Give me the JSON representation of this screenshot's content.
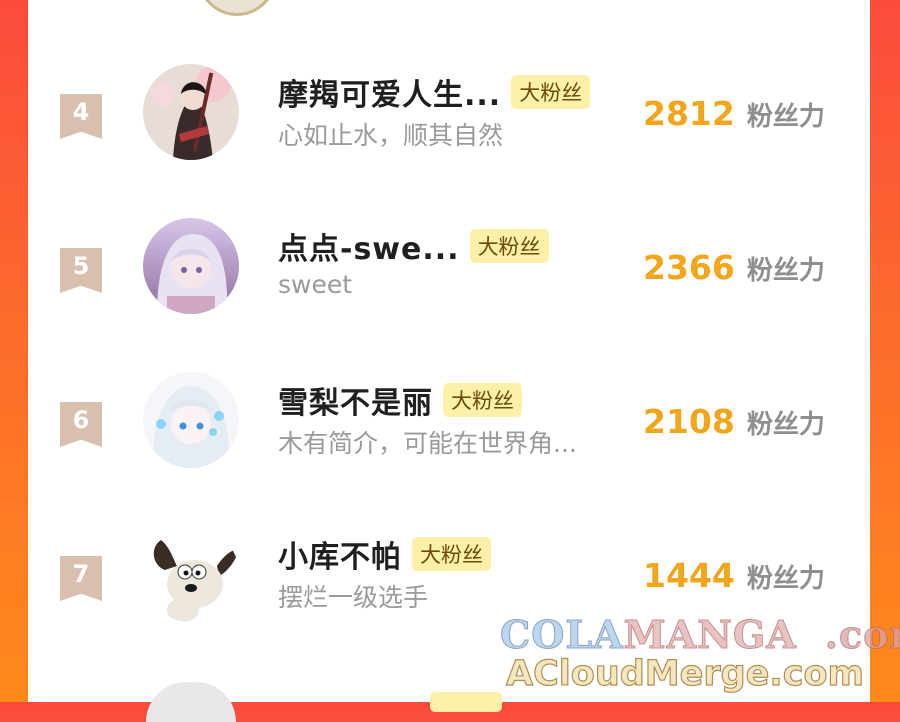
{
  "ranking": {
    "unit_label": "粉丝力",
    "badge_label": "大粉丝",
    "rows": [
      {
        "rank": "4",
        "name": "摩羯可爱人生...",
        "bio": "心如止水，顺其自然",
        "score": "2812",
        "avatar_icon": "avatar-anime-swordsman-icon"
      },
      {
        "rank": "5",
        "name": "点点-swe...",
        "bio": "sweet",
        "score": "2366",
        "avatar_icon": "avatar-anime-girl-purple-icon"
      },
      {
        "rank": "6",
        "name": "雪梨不是丽",
        "bio": "木有简介，可能在世界角...",
        "score": "2108",
        "avatar_icon": "avatar-anime-girl-white-hair-icon"
      },
      {
        "rank": "7",
        "name": "小库不帕",
        "bio": "摆烂一级选手",
        "score": "1444",
        "avatar_icon": "avatar-cartoon-dog-icon"
      }
    ]
  },
  "watermark": {
    "line1_a": "COLA",
    "line1_b": "MANGA",
    "line1_c": ".com",
    "line2": "ACloudMerge.com"
  },
  "colors": {
    "accent_score": "#f3a51c",
    "badge_bg": "#fff0a8",
    "rank_badge": "#d8bfae",
    "frame_top": "#fb4b3d",
    "frame_bottom": "#ff8a1c"
  }
}
